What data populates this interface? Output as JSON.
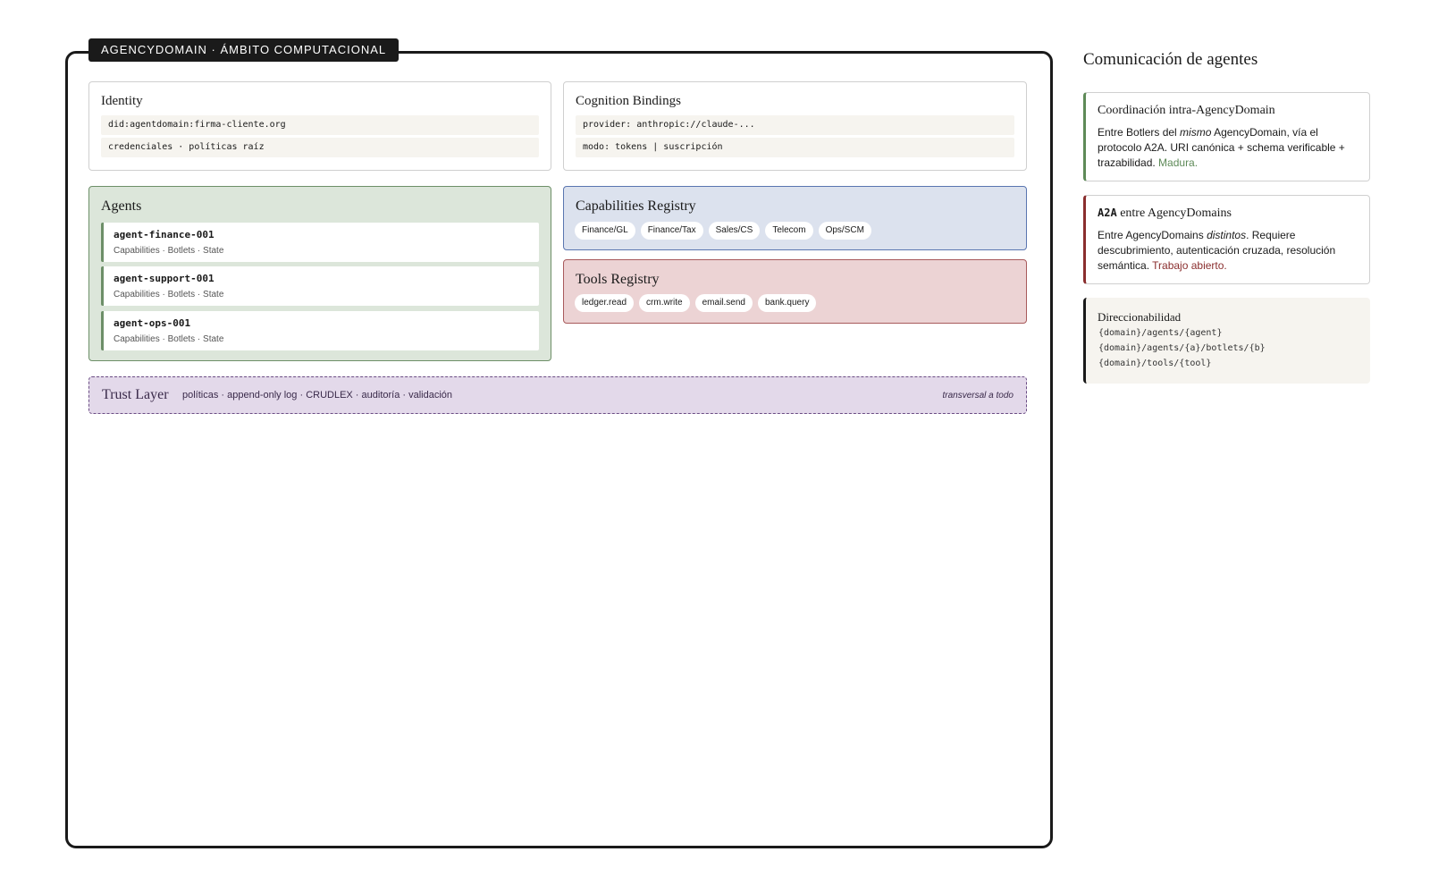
{
  "domain_frame": {
    "label": "AGENCYDOMAIN · ÁMBITO COMPUTACIONAL"
  },
  "identity": {
    "title": "Identity",
    "lines": [
      "did:agentdomain:firma-cliente.org",
      "credenciales · políticas raíz"
    ]
  },
  "cognition": {
    "title": "Cognition Bindings",
    "lines": [
      "provider: anthropic://claude-...",
      "modo: tokens | suscripción"
    ]
  },
  "agents": {
    "title": "Agents",
    "items": [
      {
        "name": "agent-finance-001",
        "sub": "Capabilities · Botlets · State"
      },
      {
        "name": "agent-support-001",
        "sub": "Capabilities · Botlets · State"
      },
      {
        "name": "agent-ops-001",
        "sub": "Capabilities · Botlets · State"
      }
    ]
  },
  "capabilities": {
    "title": "Capabilities Registry",
    "chips": [
      "Finance/GL",
      "Finance/Tax",
      "Sales/CS",
      "Telecom",
      "Ops/SCM"
    ]
  },
  "tools": {
    "title": "Tools Registry",
    "chips": [
      "ledger.read",
      "crm.write",
      "email.send",
      "bank.query"
    ]
  },
  "trust": {
    "title": "Trust Layer",
    "items": "políticas · append-only log · CRUDLEX · auditoría · validación",
    "note": "transversal a todo"
  },
  "side": {
    "title": "Comunicación de agentes",
    "intra": {
      "title": "Coordinación intra-AgencyDomain",
      "text_a": "Entre Botlers del ",
      "text_em": "mismo",
      "text_b": " AgencyDomain, vía el protocolo A2A. URI canónica + schema verificable + trazabilidad. ",
      "status": "Madura.",
      "status_color": "#5e8a58"
    },
    "inter": {
      "title_code": "A2A",
      "title_rest": " entre AgencyDomains",
      "text_a": "Entre AgencyDomains ",
      "text_em": "distintos",
      "text_b": ". Requiere descubrimiento, autenticación cruzada, resolución semántica. ",
      "status": "Trabajo abierto.",
      "status_color": "#8a2e2e"
    },
    "addressing": {
      "title": "Direccionabilidad",
      "lines": [
        "{domain}/agents/{agent}",
        "{domain}/agents/{a}/botlets/{b}",
        "{domain}/tools/{tool}"
      ]
    }
  },
  "colors": {
    "agents_accent": "#6d8f68",
    "capabilities_accent": "#5a76b0",
    "tools_accent": "#a85a5c",
    "trust_accent": "#6b4d84"
  }
}
